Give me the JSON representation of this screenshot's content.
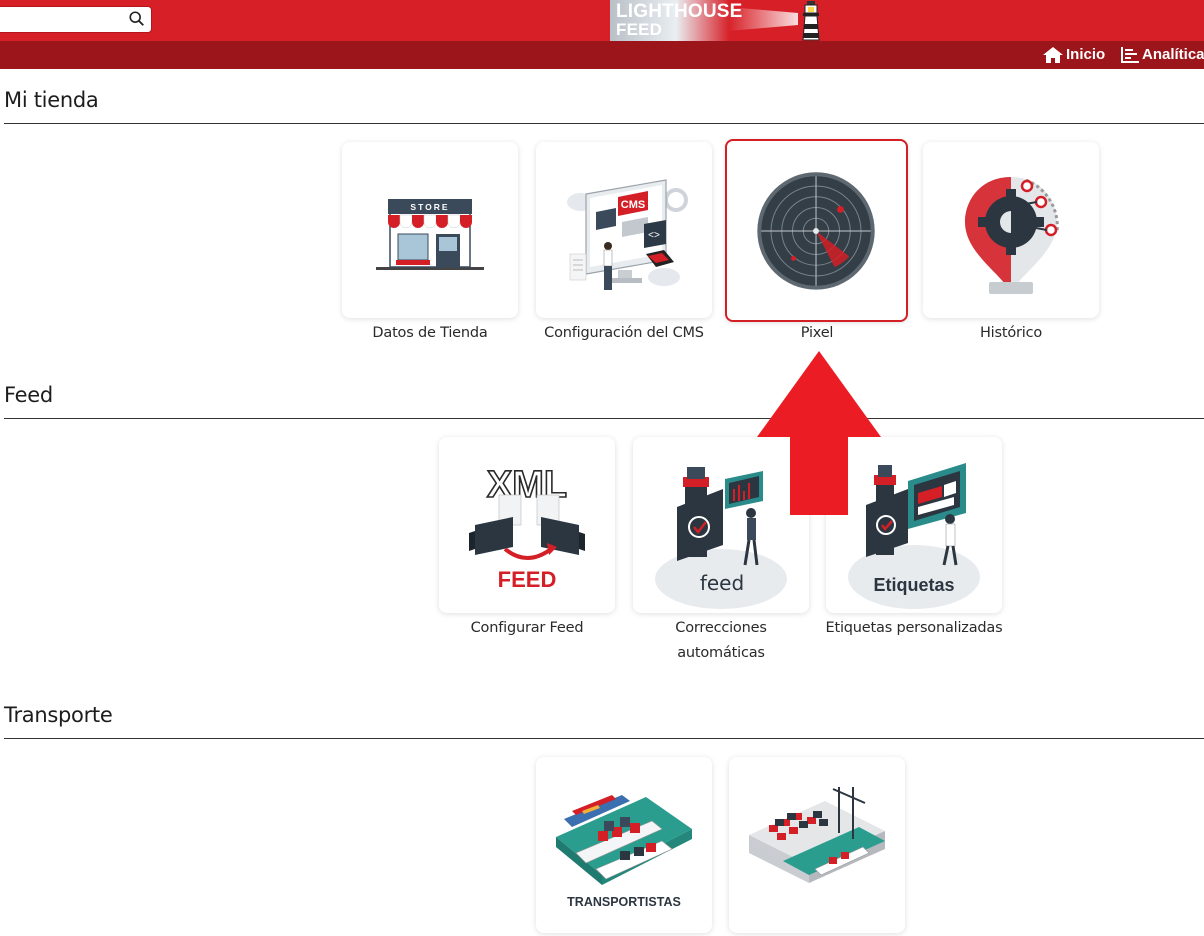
{
  "header": {
    "search": {
      "value": "",
      "placeholder": ""
    },
    "logo": {
      "line1": "LIGHTHOUSE",
      "line2": "FEED"
    },
    "nav": [
      {
        "label": "Inicio",
        "icon": "home-icon"
      },
      {
        "label": "Analítica",
        "icon": "analytics-icon"
      }
    ]
  },
  "sections": {
    "mi_tienda": {
      "title": "Mi tienda",
      "cards": [
        {
          "label": "Datos de Tienda",
          "icon": "store-illustration",
          "store_sign": "STORE"
        },
        {
          "label": "Configuración del CMS",
          "icon": "cms-illustration",
          "cms_sign": "CMS"
        },
        {
          "label": "Pixel",
          "icon": "radar-illustration",
          "selected": true
        },
        {
          "label": "Histórico",
          "icon": "history-gear-illustration"
        }
      ]
    },
    "feed": {
      "title": "Feed",
      "cards": [
        {
          "label": "Configurar Feed",
          "icon": "xml-feed-illustration",
          "art_top": "XML",
          "art_bottom": "FEED"
        },
        {
          "label_line1": "Correcciones",
          "label_line2": "automáticas",
          "icon": "feed-robot-illustration",
          "art_text": "feed"
        },
        {
          "label": "Etiquetas personalizadas",
          "icon": "labels-illustration",
          "art_text": "Etiquetas"
        }
      ]
    },
    "transporte": {
      "title": "Transporte",
      "cards": [
        {
          "label": "",
          "icon": "ships-illustration",
          "art_text": "TRANSPORTISTAS"
        },
        {
          "label": "",
          "icon": "port-cranes-illustration"
        }
      ]
    }
  },
  "annotation": {
    "icon": "red-up-arrow-icon",
    "color": "#ec1c24"
  },
  "colors": {
    "brand_red": "#d71f27",
    "nav_dark_red": "#9b151b"
  }
}
